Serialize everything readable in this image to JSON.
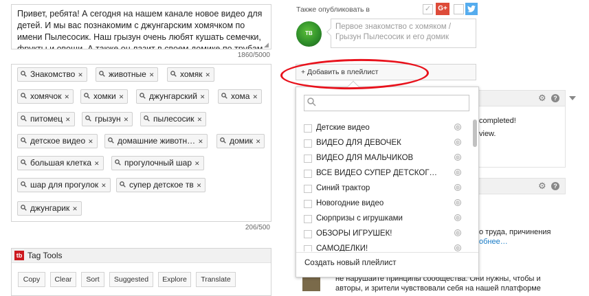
{
  "description": {
    "text": "Привет, ребята! А сегодня на нашем канале новое видео для детей. И мы вас познакомим с джунгарским хомячком по имени Пылесосик. Наш грызун очень любят кушать семечки, фрукты и овощи. А также он лазит в своем домике по трубам,",
    "counter": "1860/5000"
  },
  "tags": {
    "items": [
      "Знакомство",
      "животные",
      "хомяк",
      "хомячок",
      "хомки",
      "джунгарский",
      "хома",
      "питомец",
      "грызун",
      "пылесосик",
      "детское видео",
      "домашние животн…",
      "домик",
      "большая клетка",
      "прогулочный шар",
      "шар для прогулок",
      "супер детское тв",
      "джунгарик"
    ],
    "counter": "206/500"
  },
  "tag_tools": {
    "title": "Tag Tools",
    "logo": "tb",
    "buttons": [
      "Copy",
      "Clear",
      "Sort",
      "Suggested",
      "Explore",
      "Translate"
    ]
  },
  "share": {
    "label": "Также опубликовать в",
    "gplus": "G+",
    "twitter_icon": "twitter-icon"
  },
  "channel_avatar_label": "TB",
  "post_placeholder": "Первое знакомство с хомяком / Грызун Пылесосик и его домик",
  "add_playlist_label": "+ Добавить в плейлист",
  "playlist_menu": {
    "items": [
      "Детские видео",
      "ВИДЕО ДЛЯ ДЕВОЧЕК",
      "ВИДЕО ДЛЯ МАЛЬЧИКОВ",
      "ВСЕ ВИДЕО СУПЕР ДЕТСКОГ…",
      "Синий трактор",
      "Новогодние видео",
      "Сюрпризы с игрушками",
      "ОБЗОРЫ ИГРУШЕК!",
      "САМОДЕЛКИ!"
    ],
    "create_label": "Создать новый плейлист"
  },
  "background_panels": {
    "panel1_line1": "completed!",
    "panel1_line2": "view.",
    "panel2_line1": "о труда, причинения",
    "panel2_link1": "обнее…",
    "panel2_line2": "не нарушайте принципы сообщества. Они нужны, чтобы и",
    "panel2_line3": "авторы, и зрители чувствовали себя на нашей платформе",
    "panel2_line4": "Подробнее…"
  },
  "colors": {
    "annotation": "#e8121c",
    "gplus": "#dd4b39",
    "twitter": "#55acee",
    "link": "#167ac6"
  }
}
